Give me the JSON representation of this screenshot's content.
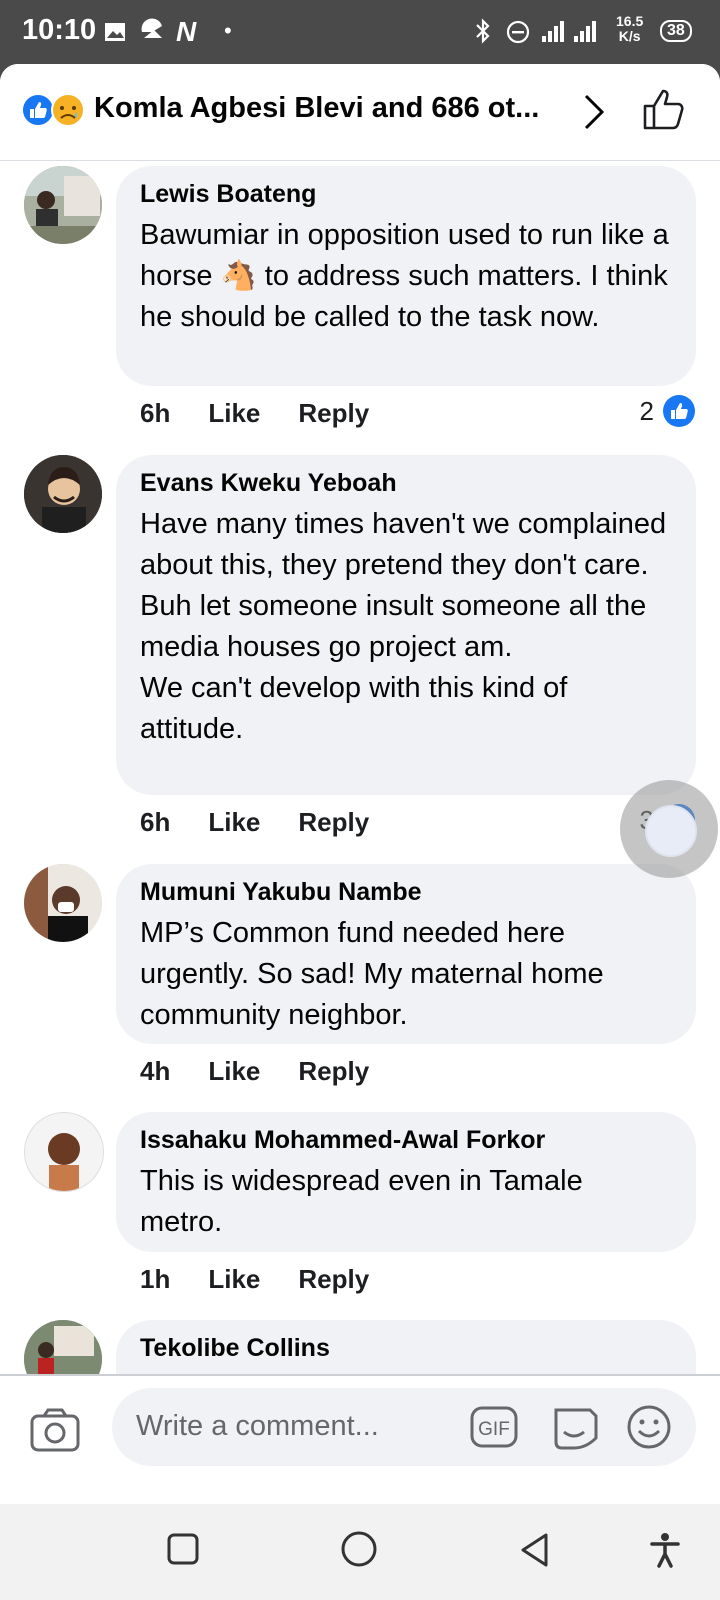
{
  "status_bar": {
    "time": "10:10",
    "speed": "16.5",
    "speed_unit": "K/s",
    "battery": "38"
  },
  "header": {
    "title": "Komla Agbesi Blevi and 686 ot..."
  },
  "comments": [
    {
      "name": "Lewis Boateng",
      "text": "Bawumiar in opposition used to run like a horse 🐴 to address such matters. I think he should be called to the task now.",
      "time": "6h",
      "like_label": "Like",
      "reply_label": "Reply",
      "likes": "2"
    },
    {
      "name": "Evans Kweku Yeboah",
      "text": "Have many times haven't we complained about this, they pretend they don't care. Buh let someone insult someone all the media houses go project am.\nWe can't develop with this kind of attitude.",
      "time": "6h",
      "like_label": "Like",
      "reply_label": "Reply",
      "likes": "3"
    },
    {
      "name": "Mumuni Yakubu Nambe",
      "text": "MP’s Common fund needed here urgently. So sad! My maternal home community neighbor.",
      "time": "4h",
      "like_label": "Like",
      "reply_label": "Reply"
    },
    {
      "name": "Issahaku Mohammed-Awal Forkor",
      "text": "This is widespread even in Tamale metro.",
      "time": "1h",
      "like_label": "Like",
      "reply_label": "Reply"
    },
    {
      "name": "Tekolibe Collins"
    }
  ],
  "composer": {
    "placeholder": "Write a comment...",
    "gif_label": "GIF"
  },
  "colors": {
    "accent": "#1877f2",
    "bubble": "#f0f2f5"
  }
}
